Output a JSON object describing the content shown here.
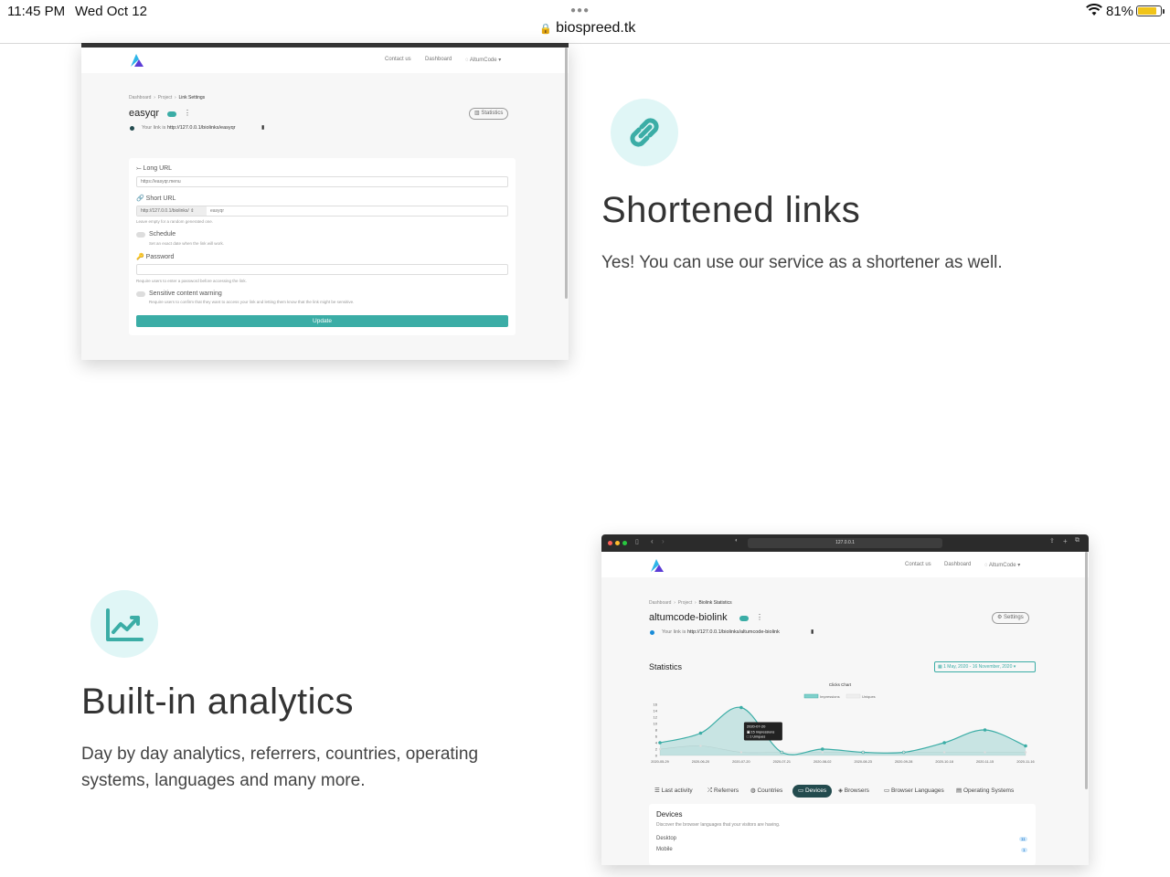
{
  "status_bar": {
    "time": "11:45 PM",
    "date": "Wed Oct 12",
    "url": "biospreed.tk",
    "battery": "81%"
  },
  "feature1": {
    "title": "Shortened links",
    "description": "Yes! You can use our service as a shortener as well.",
    "icon": "link-icon",
    "shot": {
      "nav": {
        "contact": "Contact us",
        "dashboard": "Dashboard",
        "user": "AltumCode"
      },
      "breadcrumb": {
        "b1": "Dashboard",
        "b2": "Project",
        "b3": "Link Settings"
      },
      "link_name": "easyqr",
      "stats_button": "Statistics",
      "link_label": "Your link is",
      "link_url": "http://127.0.0.1/biolinks/easyqr",
      "form": {
        "long_url_label": "Long URL",
        "long_url_value": "https://easyqr.menu",
        "short_url_label": "Short URL",
        "short_url_prefix": "http://127.0.0.1/biolinks/",
        "short_url_value": "easyqr",
        "short_url_help": "Leave empty for a random generated one.",
        "schedule_label": "Schedule",
        "schedule_help": "Set an exact date when the link will work.",
        "password_label": "Password",
        "password_help": "Require users to enter a password before accessing the link.",
        "sensitive_label": "Sensitive content warning",
        "sensitive_help": "Require users to confirm that they want to access your link and letting them know that the link might be sensitive.",
        "update_button": "Update"
      }
    }
  },
  "feature2": {
    "title": "Built-in analytics",
    "description_line1": "Day by day analytics, referrers, countries, operating",
    "description_line2": "systems, languages and many more.",
    "icon": "chart-line-icon",
    "shot": {
      "address": "127.0.0.1",
      "nav": {
        "contact": "Contact us",
        "dashboard": "Dashboard",
        "user": "AltumCode"
      },
      "breadcrumb": {
        "b1": "Dashboard",
        "b2": "Project",
        "b3": "Biolink Statistics"
      },
      "link_name": "altumcode-biolink",
      "settings_button": "Settings",
      "link_label": "Your link is",
      "link_url": "http://127.0.0.1/biolinks/altumcode-biolink",
      "statistics_heading": "Statistics",
      "date_range": "1 May, 2020 - 16 November, 2020",
      "tabs": [
        "Last activity",
        "Referrers",
        "Countries",
        "Devices",
        "Browsers",
        "Browser Languages",
        "Operating Systems"
      ],
      "devices": {
        "heading": "Devices",
        "subtitle": "Discover the browser languages that your visitors are having.",
        "rows": [
          {
            "name": "Desktop",
            "count": "11"
          },
          {
            "name": "Mobile",
            "count": "1"
          }
        ]
      },
      "chart_data": {
        "type": "area",
        "title": "Clicks Chart",
        "x": [
          "2020-05-29",
          "2020-06-20",
          "2020-07-20",
          "2020-07-21",
          "2020-08-02",
          "2020-08-23",
          "2020-09-28",
          "2020-10-18",
          "2020-11-15",
          "2020-11-16"
        ],
        "series": [
          {
            "name": "Impressions",
            "values": [
              4,
              7,
              15,
              1,
              2,
              1,
              1,
              4,
              8,
              3
            ]
          },
          {
            "name": "Uniques",
            "values": [
              2,
              3,
              1,
              1,
              1,
              1,
              1,
              1,
              1,
              1
            ]
          }
        ],
        "yticks": [
          "16",
          "14",
          "12",
          "10",
          "8",
          "6",
          "4",
          "2",
          "0"
        ],
        "ylim": [
          0,
          16
        ],
        "tooltip": {
          "date": "2020-07-20",
          "line1": "15 Impressions",
          "line2": "1 Uniques"
        },
        "color": "#3bada6"
      }
    }
  }
}
